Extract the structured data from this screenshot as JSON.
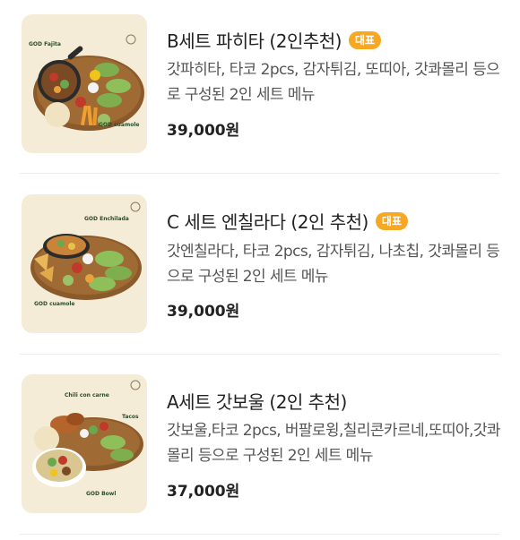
{
  "menu": {
    "items": [
      {
        "title": "B세트 파히타 (2인추천)",
        "badge": "대표",
        "description": "갓파히타, 타코 2pcs, 감자튀김, 또띠아, 갓콰몰리 등으로 구성된 2인 세트 메뉴",
        "price": "39,000원",
        "image_labels": [
          "GOD Fajita",
          "GOD cuamole"
        ]
      },
      {
        "title": "C 세트 엔칠라다 (2인 추천)",
        "badge": "대표",
        "description": "갓엔칠라다, 타코 2pcs, 감자튀김, 나초칩, 갓콰몰리 등으로 구성된 2인 세트 메뉴",
        "price": "39,000원",
        "image_labels": [
          "GOD Enchilada",
          "GOD cuamole"
        ]
      },
      {
        "title": "A세트 갓보울 (2인 추천)",
        "badge": "",
        "description": "갓보울,타코 2pcs, 버팔로윙,칠리콘카르네,또띠아,갓콰몰리 등으로 구성된 2인 세트 메뉴",
        "price": "37,000원",
        "image_labels": [
          "Chili con carne",
          "Tacos",
          "GOD Bowl"
        ]
      }
    ]
  },
  "colors": {
    "badge": "#f7a823",
    "thumb_background": "#f5ecd7",
    "board": "#8a5a2b"
  }
}
